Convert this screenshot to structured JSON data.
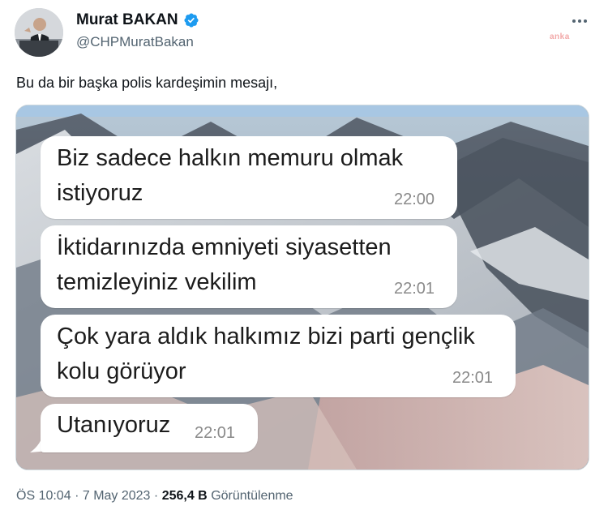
{
  "author": {
    "display_name": "Murat BAKAN",
    "handle": "@CHPMuratBakan",
    "verified_icon": "verified-badge-icon"
  },
  "watermark": "anka",
  "tweet": {
    "text": "Bu da bir başka polis kardeşimin mesajı,"
  },
  "media": {
    "messages": [
      {
        "lines": [
          "Biz sadece halkın memuru olmak",
          "istiyoruz"
        ],
        "time": "22:00"
      },
      {
        "lines": [
          "İktidarınızda emniyeti siyasetten",
          "temizleyiniz vekilim"
        ],
        "time": "22:01"
      },
      {
        "lines": [
          "Çok yara aldık halkımız bizi parti gençlik",
          "kolu görüyor"
        ],
        "time": "22:01"
      },
      {
        "lines": [
          "Utanıyoruz"
        ],
        "time": "22:01"
      }
    ]
  },
  "footer": {
    "time": "ÖS 10:04",
    "sep1": "·",
    "date": "7 May 2023",
    "sep2": "·",
    "views_count": "256,4 B",
    "views_label": "Görüntülenme"
  },
  "colors": {
    "verified": "#1d9bf0",
    "secondary_text": "#536471"
  }
}
